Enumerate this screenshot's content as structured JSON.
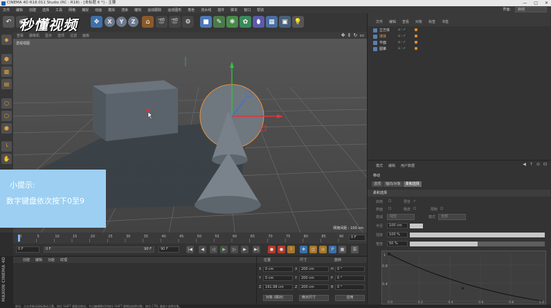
{
  "window": {
    "title": "CINEMA 4D R18.011 Studio (RC - R18) - [未标题 6 *] - 主要",
    "controls": [
      "—",
      "□",
      "✕"
    ]
  },
  "menubar": {
    "items": [
      "文件",
      "编辑",
      "创建",
      "选择",
      "工具",
      "网格",
      "捕捉",
      "动画",
      "模拟",
      "渲染",
      "雕刻",
      "运动跟踪",
      "运动图形",
      "角色",
      "流水线",
      "插件",
      "脚本",
      "窗口",
      "帮助"
    ],
    "layout_label": "界面:",
    "layout_value": "启动"
  },
  "toolbar": {
    "undo_icon": "undo-icon",
    "axis_buttons": [
      "X",
      "Y",
      "Z"
    ],
    "watermark": "秒懂视频"
  },
  "viewport": {
    "menu": [
      "查看",
      "摄像机",
      "显示",
      "选项",
      "过滤",
      "面板"
    ],
    "label": "透视视图",
    "grid_info": "网格间距 : 100 cm"
  },
  "tip": {
    "line1": "小提示:",
    "line2": "数字键盘依次按下0至9"
  },
  "timeline": {
    "ticks": [
      "0",
      "5",
      "10",
      "15",
      "20",
      "25",
      "30",
      "35",
      "40",
      "45",
      "50",
      "55",
      "60",
      "65",
      "70",
      "75",
      "80",
      "85",
      "90"
    ],
    "end_frame": "0 F",
    "playhead_fraction": 0.0
  },
  "transport": {
    "current": "0 F",
    "start": "0 F",
    "range_end": "90 F",
    "end": "90 F"
  },
  "materials": {
    "menu": [
      "创建",
      "编辑",
      "功能",
      "纹理"
    ],
    "maxon": "MAXON CINEMA 4D"
  },
  "coords": {
    "headers": [
      "位置",
      "尺寸",
      "旋转"
    ],
    "rows": [
      {
        "axis": "X",
        "pos": "0 cm",
        "size_axis": "X",
        "size": "200 cm",
        "rot_axis": "H",
        "rot": "0 °"
      },
      {
        "axis": "Y",
        "pos": "0 cm",
        "size_axis": "Y",
        "size": "200 cm",
        "rot_axis": "P",
        "rot": "0 °"
      },
      {
        "axis": "Z",
        "pos": "191.98 cm",
        "size_axis": "Z",
        "size": "200 cm",
        "rot_axis": "B",
        "rot": "0 °"
      }
    ],
    "mode1": "对象 (相对)",
    "mode2": "绝对尺寸",
    "apply": "应用"
  },
  "objects": {
    "menu": [
      "文件",
      "编辑",
      "查看",
      "对象",
      "标签",
      "书签"
    ],
    "items": [
      {
        "name": "立方体"
      },
      {
        "name": "球体"
      },
      {
        "name": "平面"
      },
      {
        "name": "圆锥"
      }
    ]
  },
  "attributes": {
    "menu": [
      "模式",
      "编辑",
      "用户数据"
    ],
    "title": "移动",
    "tabs": [
      "选项",
      "轴向/对象",
      "柔和选择"
    ],
    "section": "柔和选择",
    "enable_label": "启用",
    "preview_label": "预览",
    "surface_label": "表面",
    "rubber_label": "橡皮",
    "restrict_label": "限制",
    "falloff_label": "衰减",
    "falloff_value": "线性",
    "mode_label": "模式",
    "mode_value": "全部",
    "radius_label": "半径",
    "radius_value": "100 cm",
    "strength_label": "强度",
    "strength_value": "100 %",
    "width_label": "宽度",
    "width_value": "50 %",
    "strength_fraction": 1.0,
    "width_fraction": 0.5,
    "graph_y": [
      "1",
      "0.8",
      "0.4",
      "0.0"
    ],
    "graph_x": [
      "0.0",
      "0.2",
      "0.4",
      "0.6",
      "0.8",
      "1.0"
    ]
  },
  "status": {
    "text": "移动：点击并拖动鼠标移动元素。按住 SHIFT 键量化移动；节点编辑模式时按住 SHIFT 键增加选择对象；按住 CTRL 键减少选择对象。"
  },
  "colors": {
    "tip_bg": "#9ccff2",
    "accent_orange": "#e08b2f",
    "selection_blue": "#5b7fb0"
  }
}
